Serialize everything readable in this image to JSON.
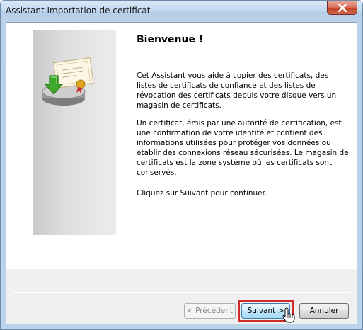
{
  "window": {
    "title": "Assistant Importation de certificat"
  },
  "content": {
    "heading": "Bienvenue !",
    "paragraph1": "Cet Assistant vous aide à copier des certificats, des listes de certificats de confiance et des listes de révocation des certificats depuis votre disque vers un magasin de certificats.",
    "paragraph2": "Un certificat, émis par une autorité de certification, est une confirmation de votre identité et contient des informations utilisées pour protéger vos données ou établir des connexions réseau sécurisées. Le magasin de certificats est la zone système où les certificats sont conservés.",
    "paragraph3": "Cliquez sur Suivant pour continuer."
  },
  "buttons": {
    "previous": "< Précédent",
    "next": "Suivant >",
    "cancel": "Annuler"
  },
  "icons": {
    "close": "close-icon",
    "illustration": "certificate-import-icon",
    "cursor": "hand-cursor-icon"
  },
  "colors": {
    "highlight": "#d12a2a",
    "close_button": "#c2442a",
    "arrow_green": "#3ea82a"
  }
}
